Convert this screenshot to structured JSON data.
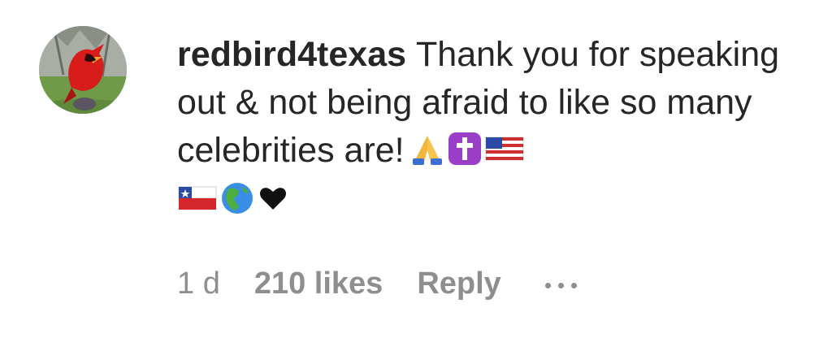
{
  "comment": {
    "username": "redbird4texas",
    "text_lines": [
      "Thank you for",
      "speaking out & not being afraid to",
      "like so many celebrities are!"
    ],
    "emojis_line1": [
      "folded-hands-emoji",
      "latin-cross-emoji",
      "us-flag-emoji"
    ],
    "emojis_line2": [
      "chile-flag-emoji",
      "globe-americas-emoji",
      "black-heart-emoji"
    ],
    "time": "1 d",
    "likes": "210 likes",
    "reply_label": "Reply",
    "more_icon": "more-options-icon"
  },
  "avatar": {
    "subject": "cardinal-bird",
    "bird_color": "#d81b1b",
    "grass_color": "#6f9a47"
  }
}
